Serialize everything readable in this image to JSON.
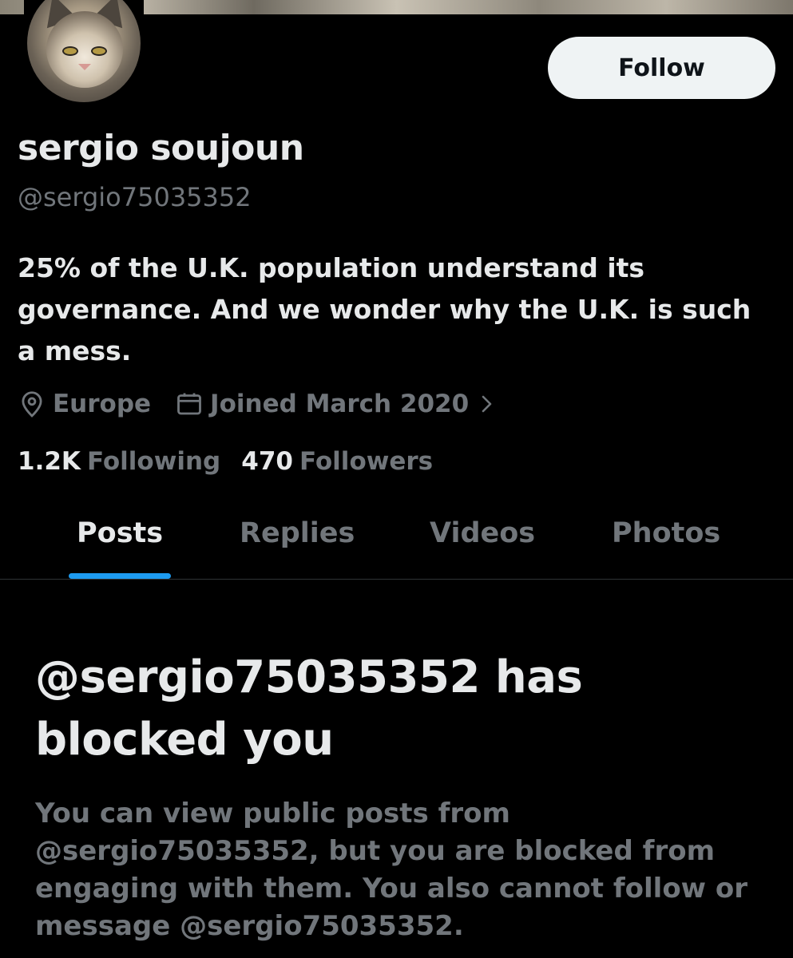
{
  "profile": {
    "display_name": "sergio soujoun",
    "handle": "@sergio75035352",
    "bio": "25% of the U.K. population understand its governance. And we wonder why the U.K. is such a mess.",
    "location": "Europe",
    "joined": "Joined March 2020",
    "following_count": "1.2K",
    "following_label": "Following",
    "followers_count": "470",
    "followers_label": "Followers"
  },
  "actions": {
    "follow_label": "Follow"
  },
  "tabs": [
    {
      "label": "Posts",
      "active": true
    },
    {
      "label": "Replies",
      "active": false
    },
    {
      "label": "Videos",
      "active": false
    },
    {
      "label": "Photos",
      "active": false
    }
  ],
  "blocked_notice": {
    "title": "@sergio75035352 has blocked you",
    "description": "You can view public posts from @sergio75035352, but you are blocked from engaging with them. You also cannot follow or message @sergio75035352."
  },
  "icons": {
    "location": "location-pin-icon",
    "joined": "calendar-icon",
    "chevron": "chevron-right-icon"
  },
  "colors": {
    "background": "#000000",
    "primary_text": "#e7e9ea",
    "secondary_text": "#71767b",
    "accent": "#1d9bf0",
    "follow_button_bg": "#eff3f4"
  }
}
